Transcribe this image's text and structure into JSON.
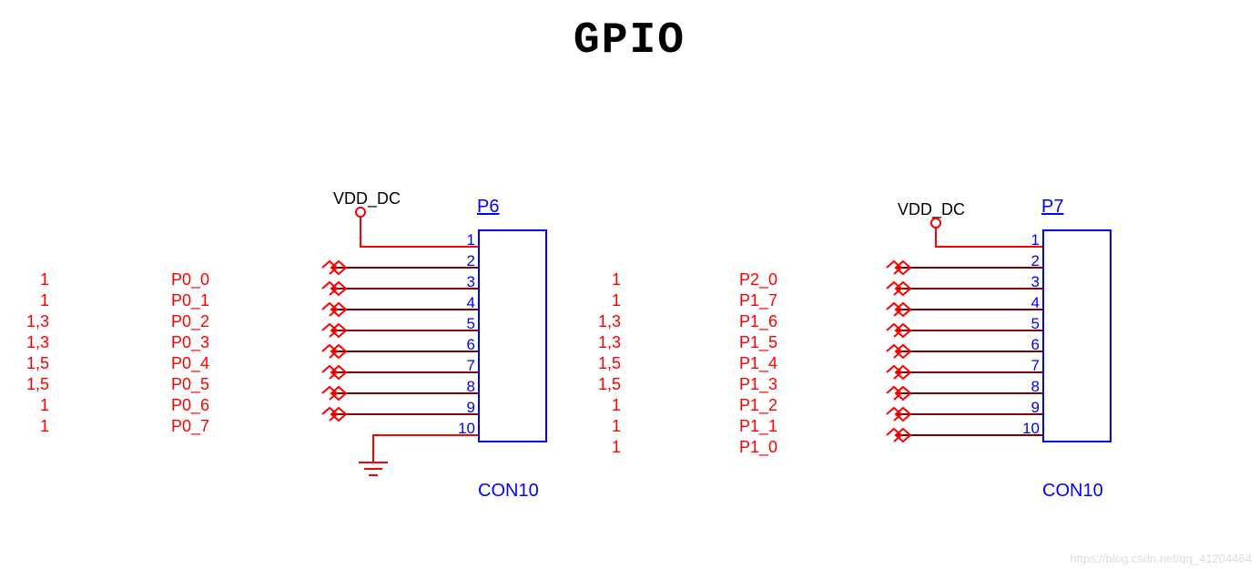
{
  "title": "GPIO",
  "watermark": "https://blog.csdn.net/qq_41204464",
  "left_block": {
    "conn_name": "P6",
    "conn_type": "CON10",
    "vdd_label": "VDD_DC",
    "pin_labels": [
      "1",
      "2",
      "3",
      "4",
      "5",
      "6",
      "7",
      "8",
      "9",
      "10"
    ],
    "idx_col": [
      "1",
      "1",
      "1,3",
      "1,3",
      "1,5",
      "1,5",
      "1",
      "1"
    ],
    "sig_col": [
      "P0_0",
      "P0_1",
      "P0_2",
      "P0_3",
      "P0_4",
      "P0_5",
      "P0_6",
      "P0_7"
    ]
  },
  "right_block": {
    "conn_name": "P7",
    "conn_type": "CON10",
    "vdd_label": "VDD_DC",
    "pin_labels": [
      "1",
      "2",
      "3",
      "4",
      "5",
      "6",
      "7",
      "8",
      "9",
      "10"
    ],
    "idx_col": [
      "1",
      "1",
      "1,3",
      "1,3",
      "1,5",
      "1,5",
      "1",
      "1",
      "1"
    ],
    "sig_col": [
      "P2_0",
      "P1_7",
      "P1_6",
      "P1_5",
      "P1_4",
      "P1_3",
      "P1_2",
      "P1_1",
      "P1_0"
    ]
  }
}
